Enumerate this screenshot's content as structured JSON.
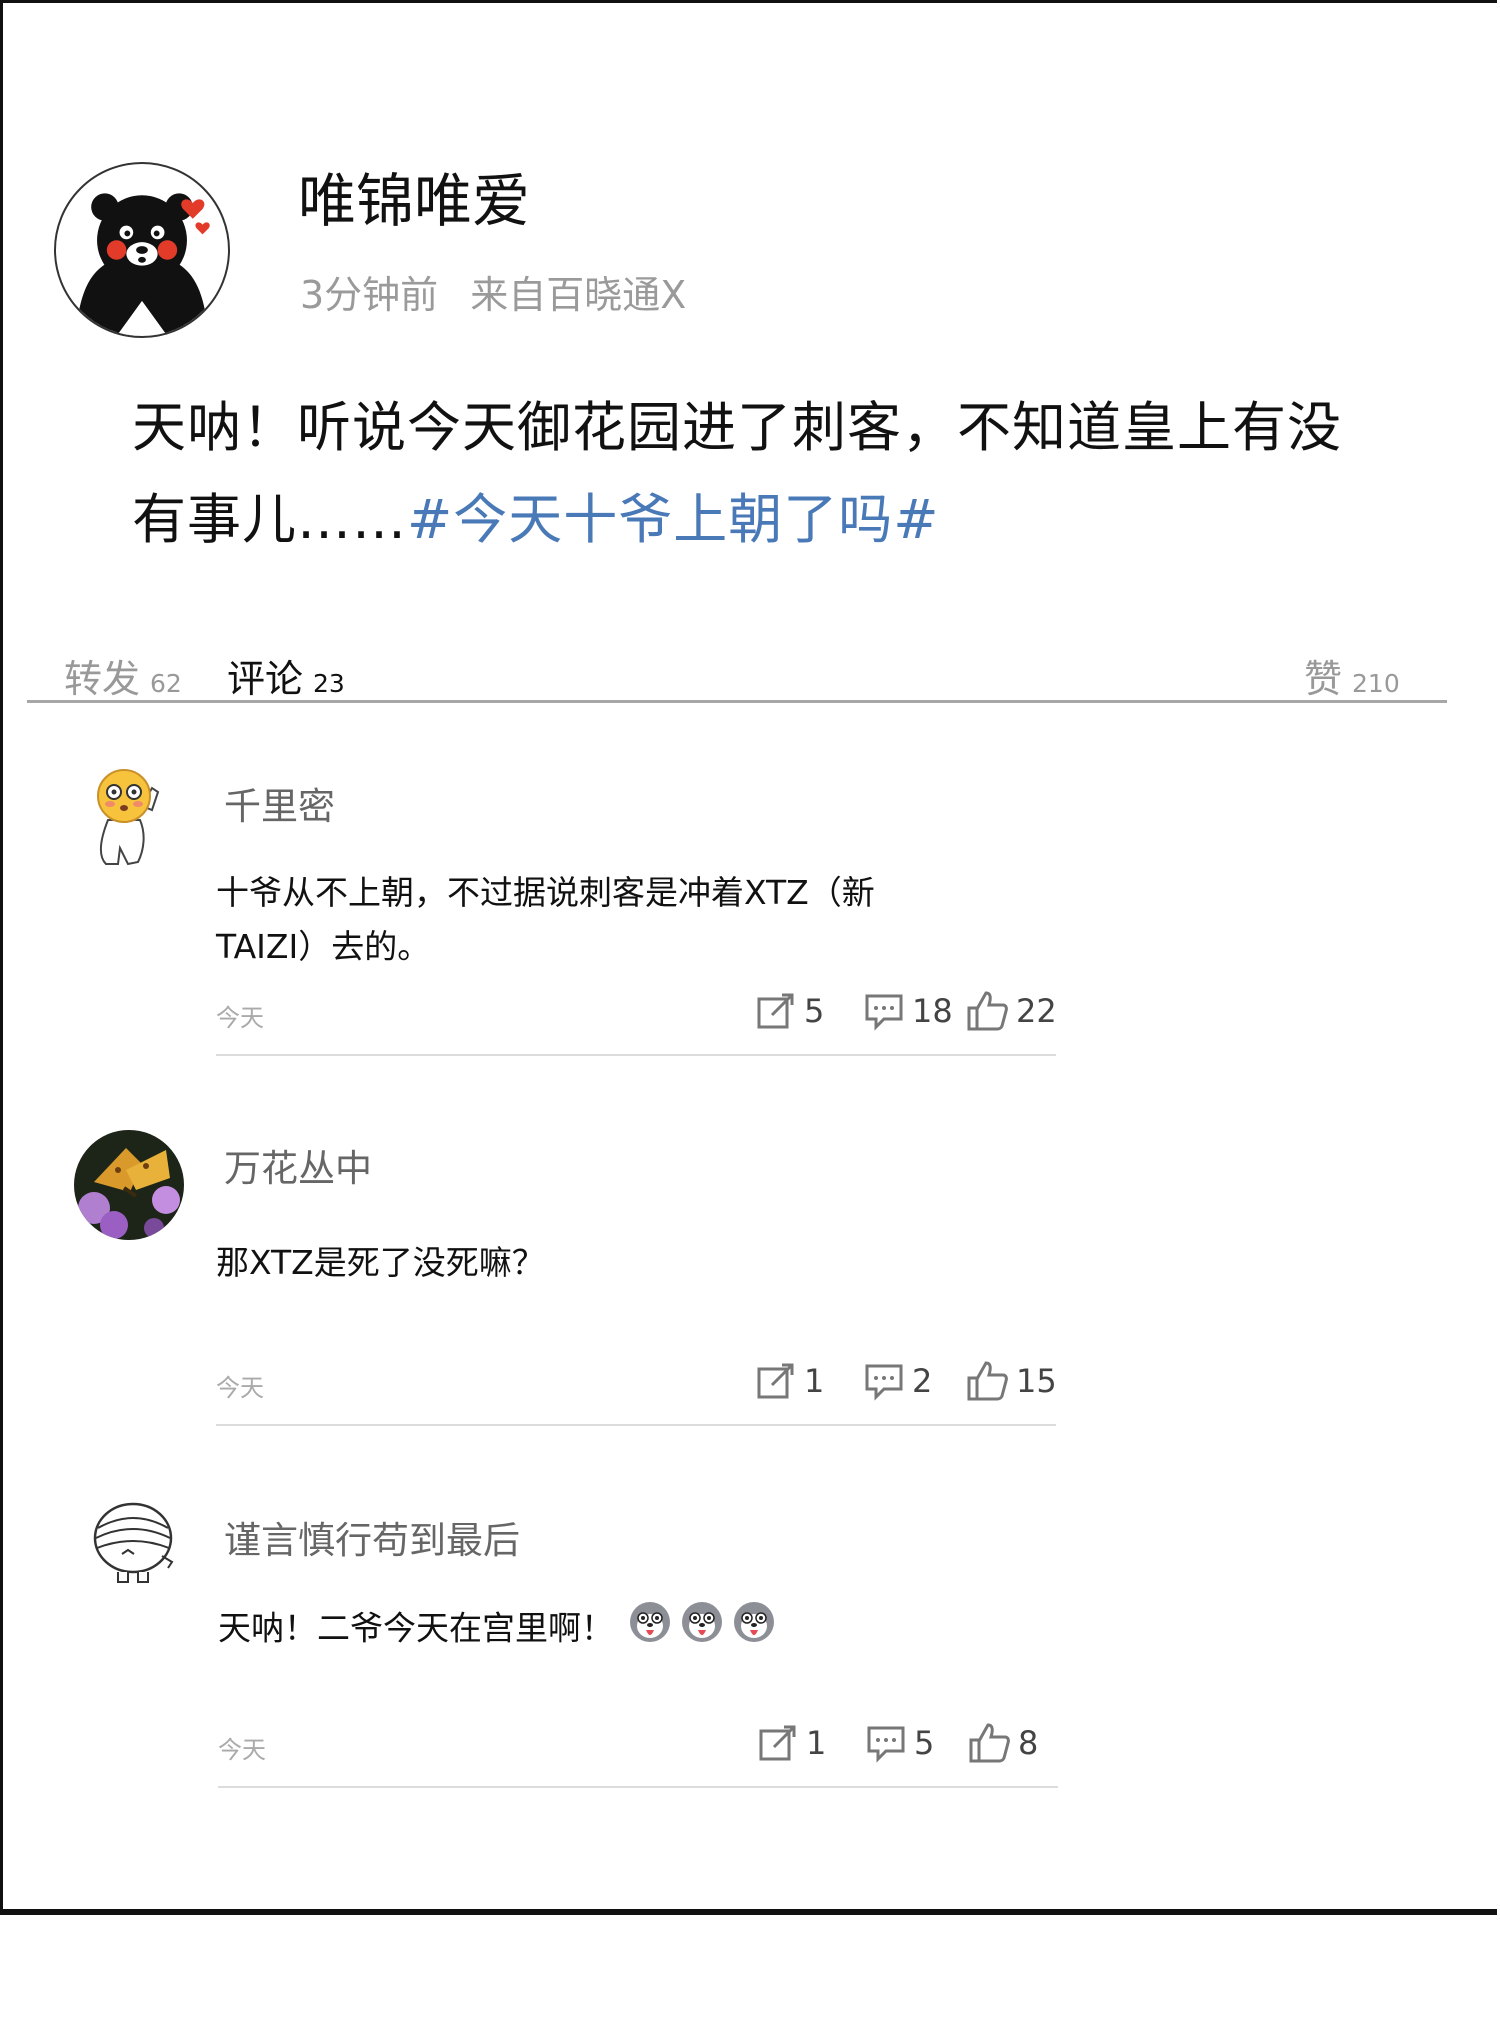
{
  "post": {
    "username": "唯锦唯爱",
    "time": "3分钟前",
    "source": "来自百晓通X",
    "text": "天呐！听说今天御花园进了刺客，不知道皇上有没有事儿……",
    "hashtag": "#今天十爷上朝了吗#",
    "avatar_icon": "kumamon-bear-avatar"
  },
  "tabs": {
    "repost_label": "转发",
    "repost_count": "62",
    "comment_label": "评论",
    "comment_count": "23",
    "like_label": "赞",
    "like_count": "210"
  },
  "comments": [
    {
      "name": "千里密",
      "text": "十爷从不上朝，不过据说刺客是冲着XTZ（新TAIZI）去的。",
      "time": "今天",
      "reposts": "5",
      "replies": "18",
      "likes": "22",
      "avatar_icon": "blushing-emoji-avatar"
    },
    {
      "name": "万花丛中",
      "text": "那XTZ是死了没死嘛？",
      "time": "今天",
      "reposts": "1",
      "replies": "2",
      "likes": "15",
      "avatar_icon": "butterfly-photo-avatar"
    },
    {
      "name": "谨言慎行苟到最后",
      "text": "天呐！二爷今天在宫里啊！",
      "time": "今天",
      "reposts": "1",
      "replies": "5",
      "likes": "8",
      "avatar_icon": "bandaged-face-avatar",
      "emojis": [
        "husky-tongue-emoji",
        "husky-tongue-emoji",
        "husky-tongue-emoji"
      ]
    }
  ],
  "colors": {
    "hashtag": "#4a79b8",
    "meta_gray": "#9a9a9a",
    "divider": "#a7a7a7"
  }
}
